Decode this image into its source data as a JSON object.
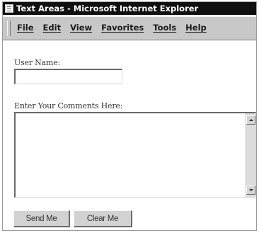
{
  "window": {
    "title": "Text Areas - Microsoft Internet Explorer"
  },
  "menu": {
    "items": [
      {
        "label": "File"
      },
      {
        "label": "Edit"
      },
      {
        "label": "View"
      },
      {
        "label": "Favorites"
      },
      {
        "label": "Tools"
      },
      {
        "label": "Help"
      }
    ]
  },
  "form": {
    "username_label": "User Name:",
    "username_value": "",
    "comments_label": "Enter Your Comments Here:",
    "comments_value": "",
    "send_label": "Send Me",
    "clear_label": "Clear Me"
  }
}
